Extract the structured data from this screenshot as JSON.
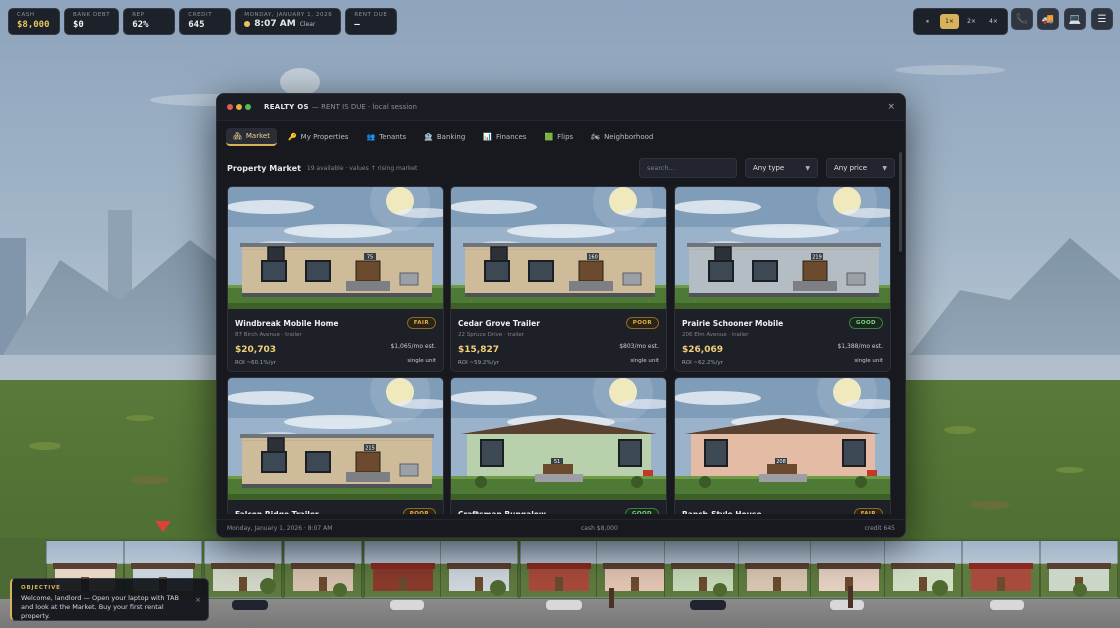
{
  "hud": {
    "stats": [
      {
        "label": "CASH",
        "value": "$8,000"
      },
      {
        "label": "BANK DEBT",
        "value": "$0"
      },
      {
        "label": "REP",
        "value": "62%"
      },
      {
        "label": "CREDIT",
        "value": "645"
      }
    ],
    "date_label": "MONDAY, JANUARY 1, 2026",
    "time": "8:07 AM",
    "weather": "Clear",
    "rent_due_label": "RENT DUE",
    "rent_due_value": "—",
    "speed": {
      "pause": "⏸",
      "s1": "1×",
      "s2": "2×",
      "s4": "4×",
      "active": "1×"
    },
    "tools": {
      "phone": "📞",
      "truck": "🚚",
      "laptop": "💻",
      "menu": "☰"
    }
  },
  "window": {
    "title": "REALTY OS",
    "subtitle": "— RENT IS DUE · local session",
    "close": "×",
    "tabs": [
      {
        "label": "Market",
        "icon": "🏘"
      },
      {
        "label": "My Properties",
        "icon": "🔑"
      },
      {
        "label": "Tenants",
        "icon": "👥"
      },
      {
        "label": "Banking",
        "icon": "🏦"
      },
      {
        "label": "Finances",
        "icon": "📊"
      },
      {
        "label": "Flips",
        "icon": "🟩"
      },
      {
        "label": "Neighborhood",
        "icon": "🏍"
      }
    ],
    "market": {
      "title": "Property Market",
      "meta": "19 available · values ↑ rising market",
      "search_placeholder": "search...",
      "type_filter": "Any type",
      "price_filter": "Any price"
    },
    "listings": [
      {
        "name": "Windbreak Mobile Home",
        "address": "87 Birch Avenue · trailer",
        "condition": "FAIR",
        "price": "$20,703",
        "rent": "$1,065/mo est.",
        "roi": "ROI ~60.1%/yr",
        "units": "single unit",
        "number": "75",
        "siding": "#cdbb9a"
      },
      {
        "name": "Cedar Grove Trailer",
        "address": "22 Spruce Drive · trailer",
        "condition": "POOR",
        "price": "$15,827",
        "rent": "$803/mo est.",
        "roi": "ROI ~59.2%/yr",
        "units": "single unit",
        "number": "160",
        "siding": "#cdbb9a"
      },
      {
        "name": "Prairie Schooner Mobile",
        "address": "206 Elm Avenue · trailer",
        "condition": "GOOD",
        "price": "$26,069",
        "rent": "$1,388/mo est.",
        "roi": "ROI ~62.2%/yr",
        "units": "single unit",
        "number": "219",
        "siding": "#b4bcc4"
      },
      {
        "name": "Falcon Ridge Trailer",
        "address": "",
        "condition": "POOR",
        "price": "",
        "rent": "",
        "roi": "",
        "units": "",
        "number": "215",
        "siding": "#cdbb9a"
      },
      {
        "name": "Craftsman Bungalow",
        "address": "",
        "condition": "GOOD",
        "price": "",
        "rent": "",
        "roi": "",
        "units": "",
        "number": "51",
        "siding": "#b8d1ac"
      },
      {
        "name": "Ranch-Style House",
        "address": "",
        "condition": "FAIR",
        "price": "",
        "rent": "",
        "roi": "",
        "units": "",
        "number": "208",
        "siding": "#e4bba5"
      }
    ],
    "status": {
      "date": "Monday, January 1, 2026 · 8:07 AM",
      "cash": "cash $8,000",
      "credit": "credit 645"
    }
  },
  "objective": {
    "label": "OBJECTIVE",
    "text": "Welcome, landlord — Open your laptop with TAB and look at the Market. Buy your first rental property.",
    "close": "×"
  }
}
